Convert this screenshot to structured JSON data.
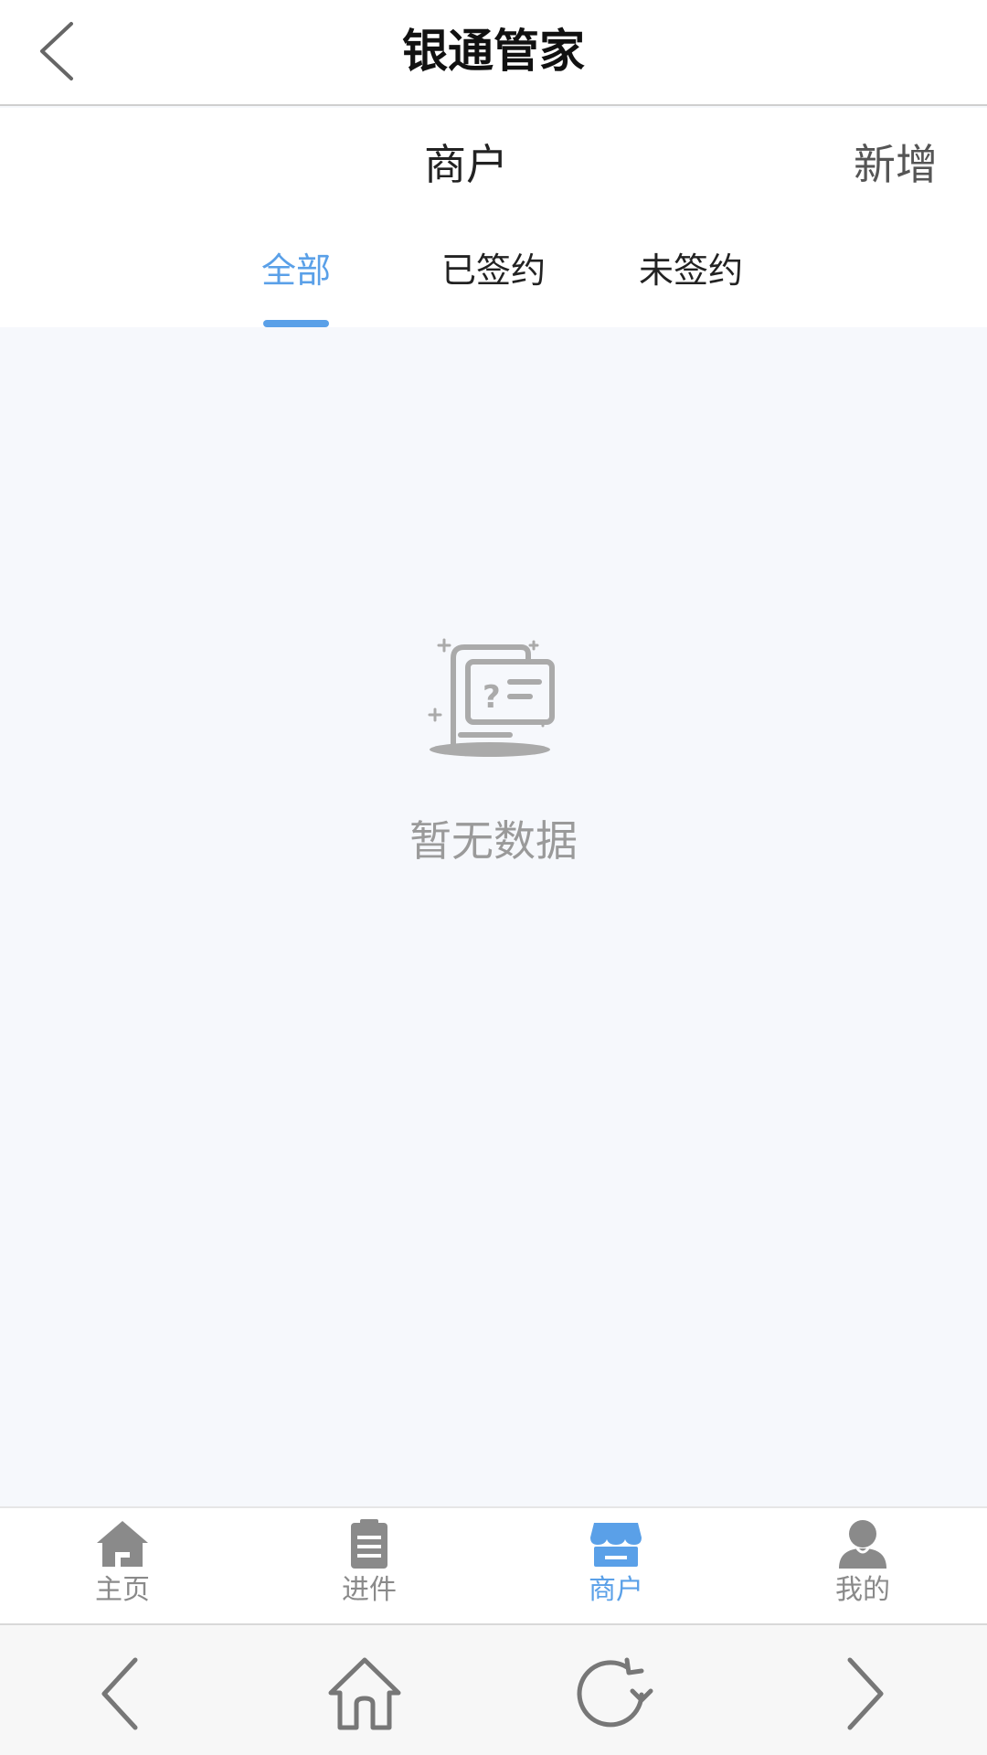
{
  "app": {
    "title": "银通管家"
  },
  "header": {
    "section_title": "商户",
    "add_label": "新增"
  },
  "tabs": [
    {
      "label": "全部",
      "active": true
    },
    {
      "label": "已签约",
      "active": false
    },
    {
      "label": "未签约",
      "active": false
    }
  ],
  "empty_state": {
    "message": "暂无数据"
  },
  "bottom_tabs": [
    {
      "label": "主页",
      "icon": "home-icon",
      "active": false
    },
    {
      "label": "进件",
      "icon": "clipboard-icon",
      "active": false
    },
    {
      "label": "商户",
      "icon": "store-icon",
      "active": true
    },
    {
      "label": "我的",
      "icon": "user-icon",
      "active": false
    }
  ],
  "browser_nav": [
    {
      "icon": "back-icon"
    },
    {
      "icon": "home-icon"
    },
    {
      "icon": "refresh-icon"
    },
    {
      "icon": "forward-icon"
    }
  ],
  "colors": {
    "accent": "#5aa0e8",
    "inactive": "#8a8a8a",
    "background": "#f6f8fc"
  }
}
